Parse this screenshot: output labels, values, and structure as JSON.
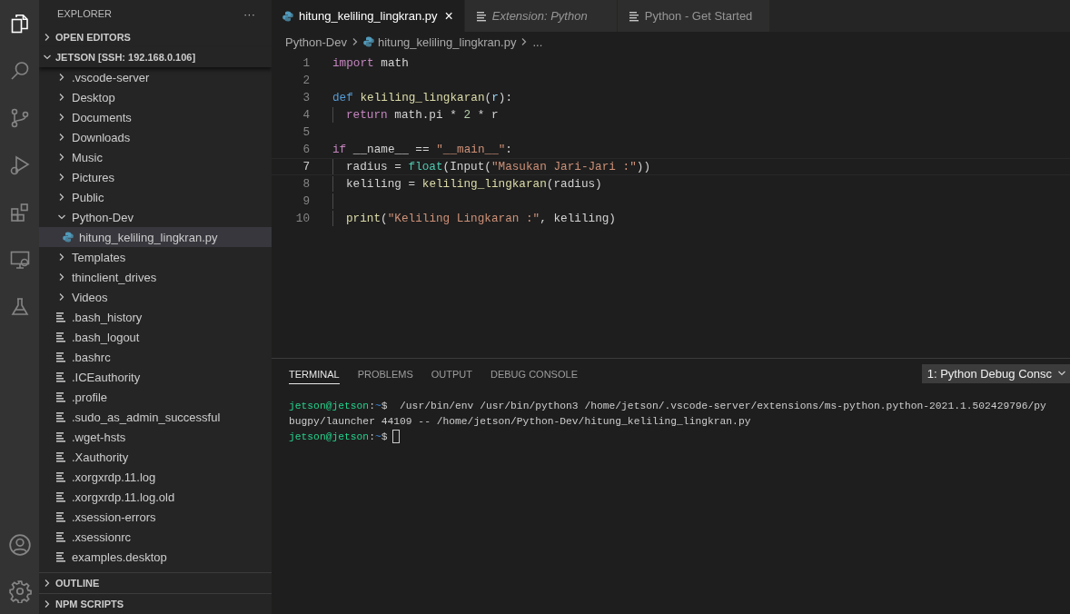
{
  "activity_bar": {
    "items": [
      {
        "kind": "files",
        "selected": true
      },
      {
        "kind": "search",
        "selected": false
      },
      {
        "kind": "source-control",
        "selected": false
      },
      {
        "kind": "run",
        "selected": false
      },
      {
        "kind": "extensions",
        "selected": false
      },
      {
        "kind": "remote",
        "selected": false
      },
      {
        "kind": "flask",
        "selected": false
      }
    ],
    "bottom": [
      {
        "kind": "account",
        "selected": false
      },
      {
        "kind": "settings",
        "selected": false
      }
    ]
  },
  "sidebar": {
    "title": "EXPLORER",
    "more": "···",
    "sections_top": [
      {
        "label": "OPEN EDITORS",
        "expanded": false
      },
      {
        "label": "JETSON [SSH: 192.168.0.106]",
        "expanded": true
      }
    ],
    "tree": [
      {
        "label": ".vscode-server",
        "kind": "folder",
        "expanded": false,
        "selected": false
      },
      {
        "label": "Desktop",
        "kind": "folder",
        "expanded": false,
        "selected": false
      },
      {
        "label": "Documents",
        "kind": "folder",
        "expanded": false,
        "selected": false
      },
      {
        "label": "Downloads",
        "kind": "folder",
        "expanded": false,
        "selected": false
      },
      {
        "label": "Music",
        "kind": "folder",
        "expanded": false,
        "selected": false
      },
      {
        "label": "Pictures",
        "kind": "folder",
        "expanded": false,
        "selected": false
      },
      {
        "label": "Public",
        "kind": "folder",
        "expanded": false,
        "selected": false
      },
      {
        "label": "Python-Dev",
        "kind": "folder",
        "expanded": true,
        "selected": false,
        "children": [
          {
            "label": "hitung_keliling_lingkran.py",
            "kind": "python",
            "selected": true
          }
        ]
      },
      {
        "label": "Templates",
        "kind": "folder",
        "expanded": false,
        "selected": false
      },
      {
        "label": "thinclient_drives",
        "kind": "folder",
        "expanded": false,
        "selected": false
      },
      {
        "label": "Videos",
        "kind": "folder",
        "expanded": false,
        "selected": false
      },
      {
        "label": ".bash_history",
        "kind": "file",
        "selected": false
      },
      {
        "label": ".bash_logout",
        "kind": "file",
        "selected": false
      },
      {
        "label": ".bashrc",
        "kind": "file",
        "selected": false
      },
      {
        "label": ".ICEauthority",
        "kind": "file",
        "selected": false
      },
      {
        "label": ".profile",
        "kind": "file",
        "selected": false
      },
      {
        "label": ".sudo_as_admin_successful",
        "kind": "file",
        "selected": false
      },
      {
        "label": ".wget-hsts",
        "kind": "file",
        "selected": false
      },
      {
        "label": ".Xauthority",
        "kind": "file",
        "selected": false
      },
      {
        "label": ".xorgxrdp.11.log",
        "kind": "file",
        "selected": false
      },
      {
        "label": ".xorgxrdp.11.log.old",
        "kind": "file",
        "selected": false
      },
      {
        "label": ".xsession-errors",
        "kind": "file",
        "selected": false
      },
      {
        "label": ".xsessionrc",
        "kind": "file",
        "selected": false
      },
      {
        "label": "examples.desktop",
        "kind": "file",
        "selected": false
      }
    ],
    "sections_bottom": [
      {
        "label": "OUTLINE",
        "expanded": false
      },
      {
        "label": "NPM SCRIPTS",
        "expanded": false
      }
    ]
  },
  "editor": {
    "tabs": [
      {
        "label": "hitung_keliling_lingkran.py",
        "kind": "python",
        "selected": true,
        "italic": false,
        "close": "×"
      },
      {
        "label": "Extension: Python",
        "kind": "doc",
        "selected": false,
        "italic": true
      },
      {
        "label": "Python - Get Started",
        "kind": "doc",
        "selected": false,
        "italic": false
      }
    ],
    "breadcrumb": [
      "Python-Dev",
      "hitung_keliling_lingkran.py",
      "..."
    ],
    "lines": [
      {
        "number": "1",
        "guide": false,
        "current": false,
        "tokens": [
          {
            "t": "import",
            "kind": "control"
          },
          {
            "t": " math",
            "kind": "plain"
          }
        ]
      },
      {
        "number": "2",
        "guide": false,
        "current": false
      },
      {
        "number": "3",
        "guide": false,
        "current": false,
        "tokens": [
          {
            "t": "def",
            "kind": "keyword"
          },
          {
            "t": " keliling_lingkaran",
            "kind": "function"
          },
          {
            "t": "(",
            "kind": "plain"
          },
          {
            "t": "r",
            "kind": "param"
          },
          {
            "t": "):",
            "kind": "plain"
          }
        ]
      },
      {
        "number": "4",
        "guide": true,
        "current": false,
        "tokens": [
          {
            "t": "return",
            "kind": "control"
          },
          {
            "t": " math.pi * ",
            "kind": "plain"
          },
          {
            "t": "2",
            "kind": "number"
          },
          {
            "t": " * r",
            "kind": "plain"
          }
        ]
      },
      {
        "number": "5",
        "guide": false,
        "current": false
      },
      {
        "number": "6",
        "guide": false,
        "current": false,
        "tokens": [
          {
            "t": "if",
            "kind": "control"
          },
          {
            "t": " __name__ == ",
            "kind": "plain"
          },
          {
            "t": "\"__main__\"",
            "kind": "string"
          },
          {
            "t": ":",
            "kind": "plain"
          }
        ]
      },
      {
        "number": "7",
        "guide": true,
        "current": true,
        "tokens": [
          {
            "t": "radius = ",
            "kind": "plain"
          },
          {
            "t": "float",
            "kind": "type"
          },
          {
            "t": "(Input(",
            "kind": "plain"
          },
          {
            "t": "\"Masukan Jari-Jari :\"",
            "kind": "string"
          },
          {
            "t": "))",
            "kind": "plain"
          }
        ]
      },
      {
        "number": "8",
        "guide": true,
        "current": false,
        "tokens": [
          {
            "t": "keliling = ",
            "kind": "plain"
          },
          {
            "t": "keliling_lingkaran",
            "kind": "function"
          },
          {
            "t": "(radius)",
            "kind": "plain"
          }
        ]
      },
      {
        "number": "9",
        "guide": true,
        "current": false
      },
      {
        "number": "10",
        "guide": true,
        "current": false,
        "tokens": [
          {
            "t": "print",
            "kind": "function"
          },
          {
            "t": "(",
            "kind": "plain"
          },
          {
            "t": "\"Keliling Lingkaran :\"",
            "kind": "string"
          },
          {
            "t": ", keliling)",
            "kind": "plain"
          }
        ]
      }
    ]
  },
  "panel": {
    "tabs": [
      {
        "label": "TERMINAL",
        "selected": true
      },
      {
        "label": "PROBLEMS",
        "selected": false
      },
      {
        "label": "OUTPUT",
        "selected": false
      },
      {
        "label": "DEBUG CONSOLE",
        "selected": false
      }
    ],
    "terminal_select": "1: Python Debug Consc",
    "terminal_lines": [
      [
        {
          "t": "jetson@jetson",
          "kind": "user"
        },
        {
          "t": ":",
          "kind": "plain"
        },
        {
          "t": "~",
          "kind": "path"
        },
        {
          "t": "$  /usr/bin/env /usr/bin/python3 /home/jetson/.vscode-server/extensions/ms-python.python-2021.1.502429796/py",
          "kind": "plain"
        }
      ],
      [
        {
          "t": "bugpy/launcher 44109 -- /home/jetson/Python-Dev/hitung_keliling_lingkran.py",
          "kind": "plain"
        }
      ],
      [
        {
          "t": "jetson@jetson",
          "kind": "user"
        },
        {
          "t": ":",
          "kind": "plain"
        },
        {
          "t": "~",
          "kind": "path"
        },
        {
          "t": "$",
          "kind": "plain"
        },
        {
          "kind": "cursor"
        }
      ]
    ]
  }
}
